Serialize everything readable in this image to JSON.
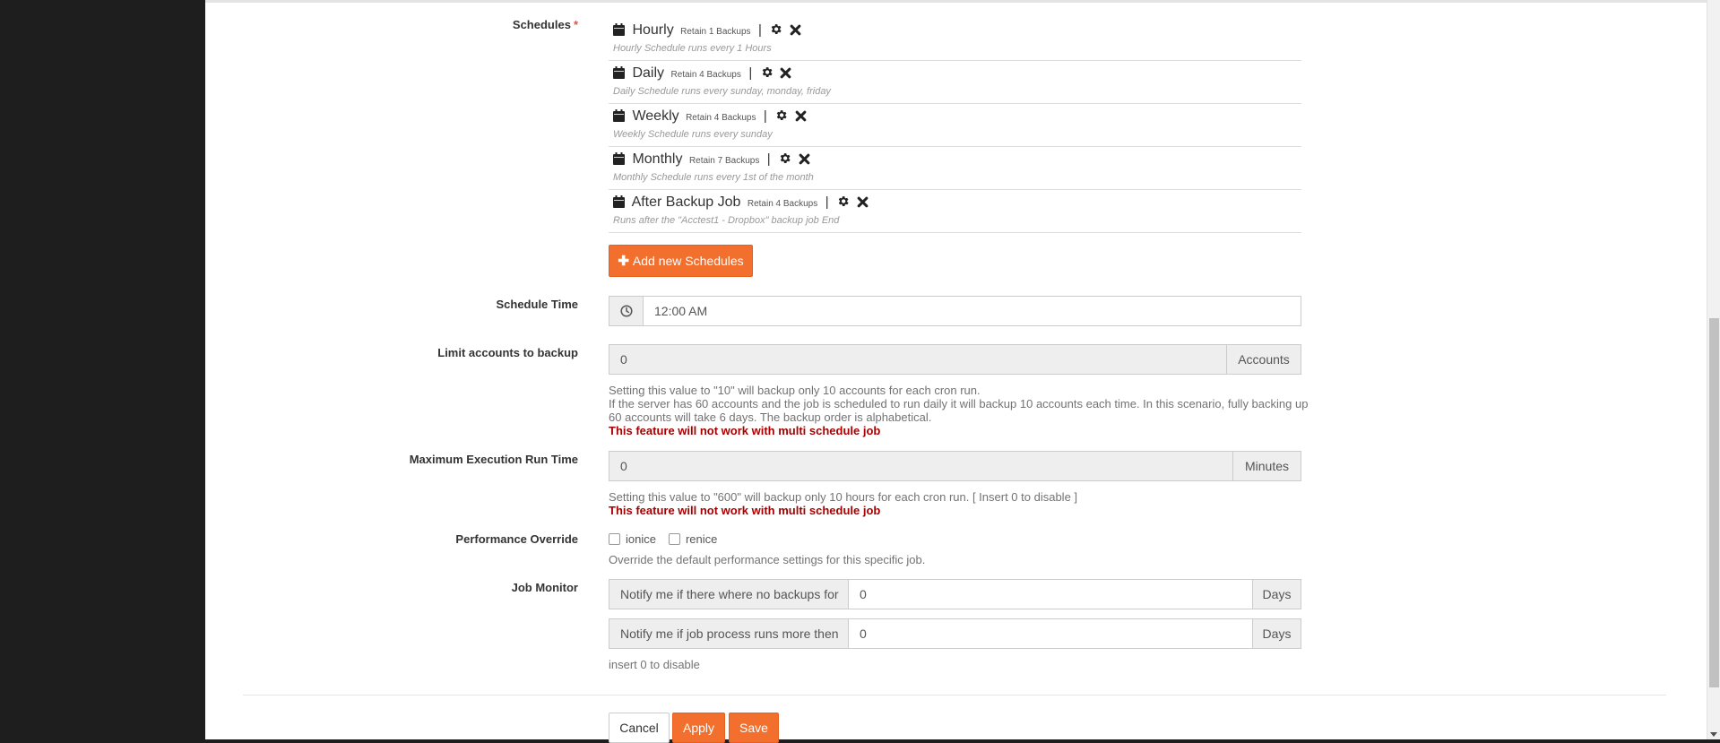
{
  "form": {
    "schedules_label": "Schedules",
    "required_mark": "*",
    "schedules": [
      {
        "name": "Hourly",
        "retain": "Retain 1 Backups",
        "desc": "Hourly Schedule runs every 1 Hours"
      },
      {
        "name": "Daily",
        "retain": "Retain 4 Backups",
        "desc": "Daily Schedule runs every sunday, monday, friday"
      },
      {
        "name": "Weekly",
        "retain": "Retain 4 Backups",
        "desc": "Weekly Schedule runs every sunday"
      },
      {
        "name": "Monthly",
        "retain": "Retain 7 Backups",
        "desc": "Monthly Schedule runs every 1st of the month"
      },
      {
        "name": "After Backup Job",
        "retain": "Retain 4 Backups",
        "desc": "Runs after the \"Acctest1 - Dropbox\" backup job End"
      }
    ],
    "separator": "|",
    "add_schedule_label": "Add new Schedules",
    "schedule_time_label": "Schedule Time",
    "schedule_time_value": "12:00 AM",
    "limit_accounts_label": "Limit accounts to backup",
    "limit_accounts_value": "0",
    "limit_accounts_unit": "Accounts",
    "limit_help_1": "Setting this value to \"10\" will backup only 10 accounts for each cron run.",
    "limit_help_2": "If the server has 60 accounts and the job is scheduled to run daily it will backup 10 accounts each time. In this scenario, fully backing up 60 accounts will take 6 days. The backup order is alphabetical.",
    "limit_warning": "This feature will not work with multi schedule job",
    "max_exec_label": "Maximum Execution Run Time",
    "max_exec_value": "0",
    "max_exec_unit": "Minutes",
    "max_exec_help": "Setting this value to \"600\" will backup only 10 hours for each cron run. [ Insert 0 to disable ]",
    "max_exec_warning": "This feature will not work with multi schedule job",
    "perf_label": "Performance Override",
    "perf_ionice": "ionice",
    "perf_renice": "renice",
    "perf_help": "Override the default performance settings for this specific job.",
    "job_monitor_label": "Job Monitor",
    "monitor_no_backups_label": "Notify me if there where no backups for",
    "monitor_no_backups_value": "0",
    "monitor_no_backups_unit": "Days",
    "monitor_runs_more_label": "Notify me if job process runs more then",
    "monitor_runs_more_value": "0",
    "monitor_runs_more_unit": "Days",
    "monitor_help": "insert 0 to disable"
  },
  "actions": {
    "cancel": "Cancel",
    "apply": "Apply",
    "save": "Save"
  },
  "colors": {
    "accent": "#f26f2d",
    "warning": "#a80000",
    "sidebar": "#1e1e1e"
  }
}
